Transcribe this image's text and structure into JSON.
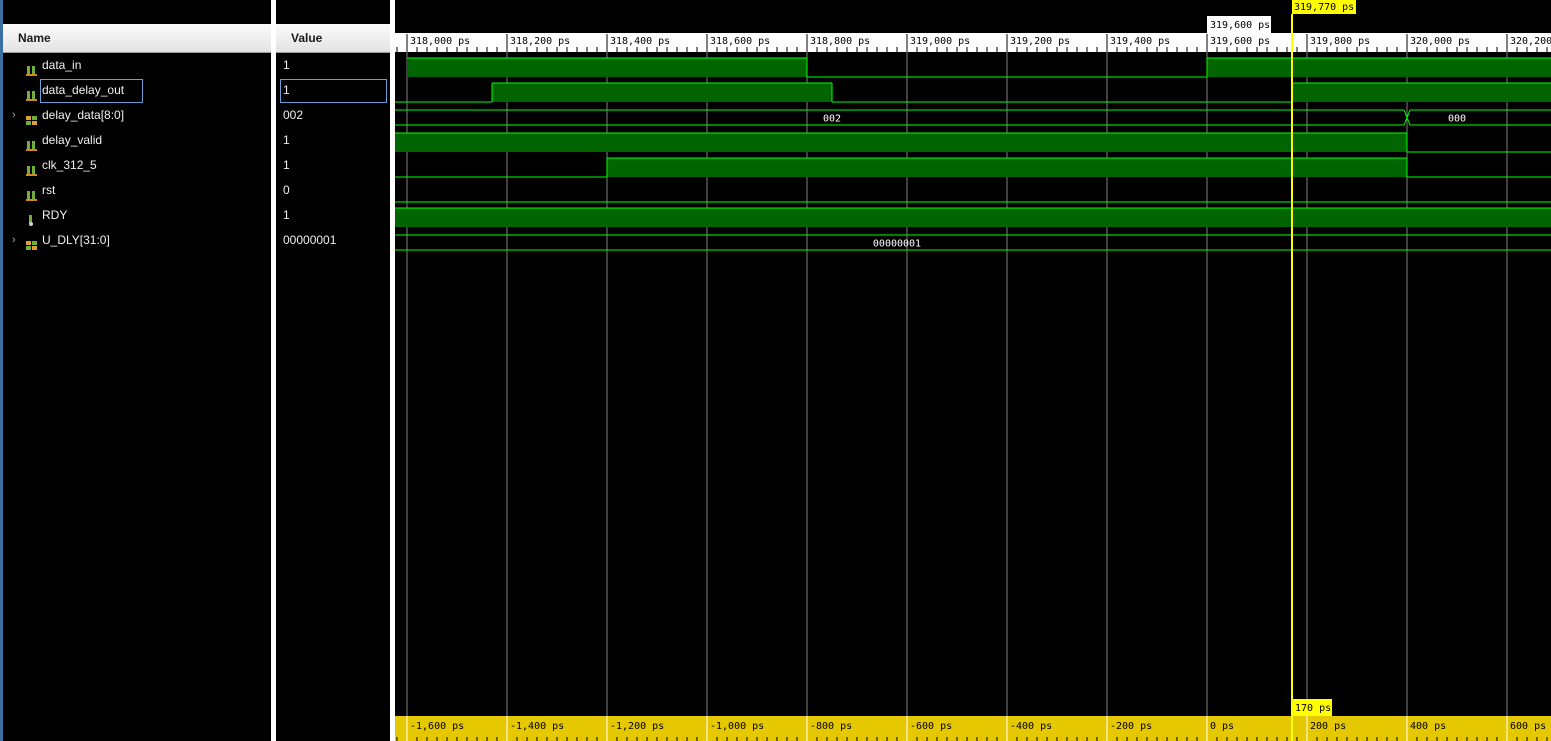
{
  "columns": {
    "name_header": "Name",
    "value_header": "Value"
  },
  "signals": [
    {
      "name": "data_in",
      "value": "1",
      "icon": "scalar-signal-icon",
      "expandable": false
    },
    {
      "name": "data_delay_out",
      "value": "1",
      "icon": "scalar-signal-icon",
      "expandable": false
    },
    {
      "name": "delay_data[8:0]",
      "value": "002",
      "icon": "bus-signal-icon",
      "expandable": true
    },
    {
      "name": "delay_valid",
      "value": "1",
      "icon": "scalar-signal-icon",
      "expandable": false
    },
    {
      "name": "clk_312_5",
      "value": "1",
      "icon": "scalar-signal-icon",
      "expandable": false
    },
    {
      "name": "rst",
      "value": "0",
      "icon": "scalar-signal-icon",
      "expandable": false
    },
    {
      "name": "RDY",
      "value": "1",
      "icon": "output-signal-icon",
      "expandable": false
    },
    {
      "name": "U_DLY[31:0]",
      "value": "00000001",
      "icon": "bus-signal-icon",
      "expandable": true
    }
  ],
  "timeline": {
    "top_ticks": [
      "318,000 ps",
      "318,200 ps",
      "318,400 ps",
      "318,600 ps",
      "318,800 ps",
      "319,000 ps",
      "319,200 ps",
      "319,400 ps",
      "319,600 ps",
      "319,800 ps",
      "320,000 ps",
      "320,200 ps"
    ],
    "top_tick_times": [
      318000,
      318200,
      318400,
      318600,
      318800,
      319000,
      319200,
      319400,
      319600,
      319800,
      320000,
      320200
    ],
    "bottom_ticks": [
      "-1,600 ps",
      "-1,400 ps",
      "-1,200 ps",
      "-1,000 ps",
      "-800 ps",
      "-600 ps",
      "-400 ps",
      "-200 ps",
      "0 ps",
      "200 ps",
      "400 ps",
      "600 ps"
    ],
    "marker_label": "319,600 ps",
    "marker_time": 319600,
    "cursor_label": "319,770 ps",
    "cursor_time": 319770,
    "delta_label": "170 ps",
    "colors": {
      "wave": "#00ff00",
      "wave_fill": "#006400",
      "cursor": "#ffff00",
      "grid": "#808080",
      "ruler_bottom": "#e6c800"
    }
  },
  "waveforms": [
    {
      "kind": "bit",
      "segments": [
        [
          318000,
          318800,
          1
        ],
        [
          318800,
          319600,
          0
        ],
        [
          319600,
          320300,
          1
        ]
      ]
    },
    {
      "kind": "bit",
      "segments": [
        [
          317900,
          318170,
          0
        ],
        [
          318170,
          318850,
          1
        ],
        [
          318850,
          319770,
          0
        ],
        [
          319770,
          320300,
          1
        ]
      ]
    },
    {
      "kind": "bus",
      "transitions": [
        320000
      ],
      "labels": [
        {
          "t": 318850,
          "text": "002"
        },
        {
          "t": 320100,
          "text": "000"
        }
      ]
    },
    {
      "kind": "bit",
      "segments": [
        [
          317900,
          320000,
          1
        ],
        [
          320000,
          320300,
          0
        ]
      ]
    },
    {
      "kind": "bit",
      "segments": [
        [
          317900,
          318400,
          0
        ],
        [
          318400,
          320000,
          1
        ],
        [
          320000,
          320300,
          0
        ]
      ]
    },
    {
      "kind": "bit",
      "segments": [
        [
          317900,
          320300,
          0
        ]
      ]
    },
    {
      "kind": "bit",
      "segments": [
        [
          317900,
          320300,
          1
        ]
      ]
    },
    {
      "kind": "bus",
      "transitions": [],
      "labels": [
        {
          "t": 318980,
          "text": "00000001"
        }
      ]
    }
  ]
}
